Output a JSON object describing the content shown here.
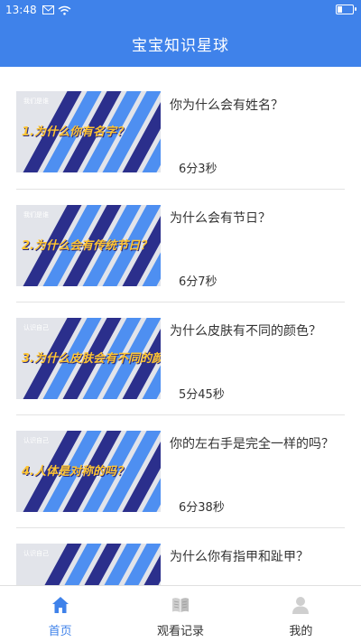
{
  "status": {
    "time": "13:48",
    "icons": [
      "mail-icon",
      "wifi-icon",
      "battery-icon"
    ]
  },
  "app": {
    "title": "宝宝知识星球"
  },
  "colors": {
    "primary": "#3f82ea",
    "thumb_stripe_dark": "#2b2f8c",
    "thumb_stripe_light": "#4e8ff1",
    "thumb_text": "#ffc531"
  },
  "items": [
    {
      "title": "你为什么会有姓名？",
      "duration": "6分3秒",
      "thumb_small": "我们是谁",
      "thumb_title": "1.为什么你有名字？"
    },
    {
      "title": "为什么会有节日？",
      "duration": "6分7秒",
      "thumb_small": "我们是谁",
      "thumb_title": "2.为什么会有传统节日？"
    },
    {
      "title": "为什么皮肤有不同的颜色？",
      "duration": "5分45秒",
      "thumb_small": "认识自己",
      "thumb_title": "3.为什么皮肤会有不同的颜色？"
    },
    {
      "title": "你的左右手是完全一样的吗？",
      "duration": "6分38秒",
      "thumb_small": "认识自己",
      "thumb_title": "4.人体是对称的吗？"
    },
    {
      "title": "为什么你有指甲和趾甲？",
      "duration": "",
      "thumb_small": "认识自己",
      "thumb_title": ""
    }
  ],
  "tabs": [
    {
      "label": "首页",
      "icon": "home-icon",
      "active": true
    },
    {
      "label": "观看记录",
      "icon": "book-icon",
      "active": false
    },
    {
      "label": "我的",
      "icon": "person-icon",
      "active": false
    }
  ]
}
